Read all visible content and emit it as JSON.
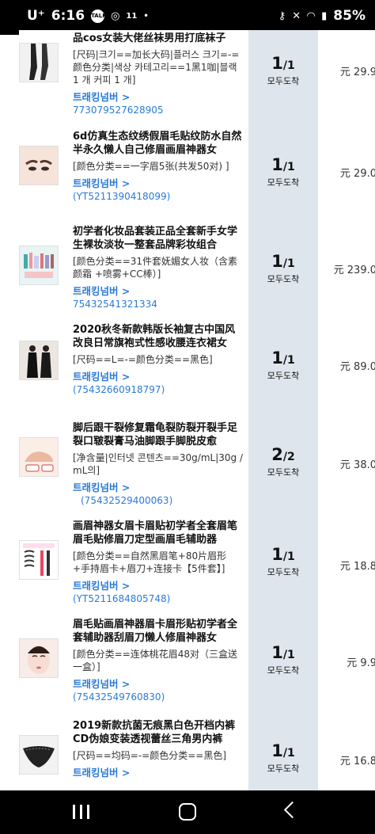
{
  "status_bar": {
    "carrier": "U⁺",
    "time": "6:16",
    "talk_badge": "TALK",
    "extra": "11",
    "dot": "•",
    "battery": "85%",
    "icons": [
      "key-icon",
      "mute-icon",
      "wifi-icon",
      "signal-icon"
    ]
  },
  "status_label_col": "status-column",
  "orders": [
    {
      "title": "品cos女装大佬丝袜男用打底袜子",
      "options": "[尺码|크기==加长大码|플러스 크기=-=颜色分类|색상 카테고리==1黑1咖|블랙 1 개 커피 1 개]",
      "tracking_label": "",
      "tracking_number": "773079527628905",
      "qty": "1",
      "total": "1",
      "status": "모두도착",
      "price": "元 29.9",
      "thumb_icon": "stockings-photo"
    },
    {
      "title": "6d仿真生态纹绣假眉毛贴纹防水自然半永久懒人自己修眉画眉神器女",
      "options": "[颜色分类==一字眉5张(共发50对) ]",
      "tracking_label": "트래킹넘버 >",
      "tracking_number": "(YT5211390418099)",
      "qty": "1",
      "total": "1",
      "status": "모두도착",
      "price": "元 29.0",
      "thumb_icon": "eyebrow-photo"
    },
    {
      "title": "初学者化妆品套装正品全套新手女学生裸妆淡妆一整套品牌彩妆组合",
      "options": "[颜色分类==31件套妩媚女人妆（含素颜霜 +喷雾+CC棒）]",
      "tracking_label": "트래킹넘버 >",
      "tracking_number": "75432541321334",
      "qty": "1",
      "total": "1",
      "status": "모두도착",
      "price": "元 239.0",
      "thumb_icon": "cosmetics-photo"
    },
    {
      "title": "2020秋冬新款韩版长袖复古中国风改良日常旗袍式性感收腰连衣裙女",
      "options": "[尺码==L=-=颜色分类==黑色]",
      "tracking_label": "트래킹넘버 >",
      "tracking_number": "(75432660918797)",
      "qty": "1",
      "total": "1",
      "status": "모두도착",
      "price": "元 89.0",
      "thumb_icon": "dress-photo"
    },
    {
      "title": "脚后跟干裂修复霜龟裂防裂开裂手足裂口皲裂膏马油脚跟手脚脱皮愈",
      "options": "[净含量|인터넷 콘텐츠==30g/mL|30g / mL의]",
      "tracking_label": "트래킹넘버 >",
      "tracking_number": "(75432529400063)",
      "qty": "2",
      "total": "2",
      "status": "모두도착",
      "price": "元 38.0",
      "thumb_icon": "foot-cream-photo"
    },
    {
      "title": "画眉神器女眉卡眉贴初学者全套眉笔眉毛贴修眉刀定型画眉毛辅助器",
      "options": "[颜色分类==自然黑眉笔+80片眉形+手持眉卡+眉刀+连接卡【5件套】]",
      "tracking_label": "트래킹넘버 >",
      "tracking_number": "(YT5211684805748)",
      "qty": "1",
      "total": "1",
      "status": "모두도착",
      "price": "元 18.8",
      "thumb_icon": "brow-kit-photo"
    },
    {
      "title": "眉毛贴画眉神器眉卡眉形贴初学者全套辅助器刮眉刀懒人修眉神器女",
      "options": "[颜色分类==连体桃花眉48对（三盒送一盒）]",
      "tracking_label": "트래킹넘버 >",
      "tracking_number": "(75432549760830)",
      "qty": "1",
      "total": "1",
      "status": "모두도착",
      "price": "元 9.9",
      "thumb_icon": "face-photo"
    },
    {
      "title": "2019新款抗菌无痕黑白色开档内裤CD伪娘变装透视蕾丝三角男内裤",
      "options": "[尺码==均码=-=颜色分类==黑色]",
      "tracking_label": "트래킹넘버 >",
      "tracking_number": "",
      "qty": "1",
      "total": "1",
      "status": "모두도착",
      "price": "元 16.8",
      "thumb_icon": "lace-photo"
    }
  ],
  "nav_bar": {
    "icons": [
      "recent-apps-icon",
      "home-icon",
      "back-icon"
    ]
  }
}
